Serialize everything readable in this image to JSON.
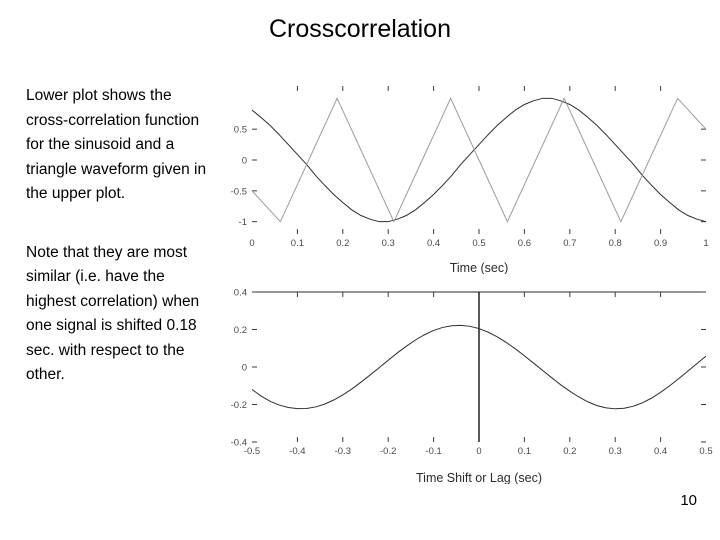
{
  "slide": {
    "title": "Crosscorrelation",
    "page_number": "10"
  },
  "text": {
    "paragraph_one": "Lower plot shows the cross-correlation function for the sinusoid and a triangle waveform given in the upper plot.",
    "paragraph_two": "Note that they are most similar (i.e. have the highest correlation) when one signal is shifted 0.18 sec. with respect to the other."
  },
  "chart_data": [
    {
      "id": "upper-plot",
      "type": "line",
      "title": "",
      "xlabel": "Time (sec)",
      "ylabel": "",
      "xlim": [
        0,
        1
      ],
      "ylim": [
        -1.2,
        1.2
      ],
      "xticks": [
        0,
        0.1,
        0.2,
        0.3,
        0.4,
        0.5,
        0.6,
        0.7,
        0.8,
        0.9,
        1
      ],
      "xticklabels": [
        "0",
        "0.1",
        "0.2",
        "0.3",
        "0.4",
        "0.5",
        "0.6",
        "0.7",
        "0.8",
        "0.9",
        "1"
      ],
      "yticks": [
        -1,
        -0.5,
        0,
        0.5
      ],
      "yticklabels": [
        "-1",
        "-0.5",
        "0",
        "0.5"
      ],
      "grid": false,
      "legend": "none",
      "series": [
        {
          "name": "sinusoid",
          "style": "solid-dark",
          "comment": "cosine-like, amplitude 1, period 0.5 sec, phase shifted",
          "x": [
            0,
            0.02,
            0.04,
            0.06,
            0.08,
            0.1,
            0.12,
            0.14,
            0.16,
            0.18,
            0.2,
            0.22,
            0.24,
            0.26,
            0.28,
            0.3,
            0.32,
            0.34,
            0.36,
            0.38,
            0.4,
            0.42,
            0.44,
            0.46,
            0.48,
            0.5,
            0.52,
            0.54,
            0.56,
            0.58,
            0.6,
            0.62,
            0.64,
            0.66,
            0.68,
            0.7,
            0.72,
            0.74,
            0.76,
            0.78,
            0.8,
            0.82,
            0.84,
            0.86,
            0.88,
            0.9,
            0.92,
            0.94,
            0.96,
            0.98,
            1
          ],
          "y": [
            0.81,
            0.69,
            0.56,
            0.41,
            0.25,
            0.09,
            -0.07,
            -0.25,
            -0.41,
            -0.56,
            -0.69,
            -0.81,
            -0.9,
            -0.96,
            -1.0,
            -1.0,
            -0.96,
            -0.9,
            -0.81,
            -0.69,
            -0.56,
            -0.41,
            -0.25,
            -0.07,
            0.09,
            0.25,
            0.41,
            0.56,
            0.69,
            0.81,
            0.9,
            0.96,
            1.0,
            1.0,
            0.96,
            0.9,
            0.81,
            0.69,
            0.56,
            0.41,
            0.25,
            0.09,
            -0.07,
            -0.25,
            -0.41,
            -0.56,
            -0.69,
            -0.81,
            -0.9,
            -0.96,
            -1.0
          ]
        },
        {
          "name": "triangle waveform",
          "style": "solid-faint",
          "comment": "triangle wave, amplitude 1, period 0.5 sec",
          "x": [
            0,
            0.0625,
            0.1875,
            0.3125,
            0.4375,
            0.5625,
            0.6875,
            0.8125,
            0.9375,
            1.0
          ],
          "y": [
            -0.5,
            -1.0,
            1.0,
            -1.0,
            1.0,
            -1.0,
            1.0,
            -1.0,
            1.0,
            0.5
          ]
        }
      ]
    },
    {
      "id": "lower-plot",
      "type": "line",
      "title": "",
      "xlabel": "Time Shift or Lag (sec)",
      "ylabel": "",
      "xlim": [
        -0.5,
        0.5
      ],
      "ylim": [
        -0.4,
        0.4
      ],
      "xticks": [
        -0.5,
        -0.4,
        -0.3,
        -0.2,
        -0.1,
        0,
        0.1,
        0.2,
        0.3,
        0.4,
        0.5
      ],
      "xticklabels": [
        "-0.5",
        "-0.4",
        "-0.3",
        "-0.2",
        "-0.1",
        "0",
        "0.1",
        "0.2",
        "0.3",
        "0.4",
        "0.5"
      ],
      "yticks": [
        -0.4,
        -0.2,
        0,
        0.2,
        0.4
      ],
      "yticklabels": [
        "-0.4",
        "-0.2",
        "0",
        "0.2",
        "0.4"
      ],
      "grid": false,
      "legend": "none",
      "annotations": [
        {
          "type": "vline",
          "x": 0,
          "label": ""
        }
      ],
      "series": [
        {
          "name": "crosscorrelation function",
          "style": "solid-dark",
          "comment": "peak correlation approx 0.22 at lag -0.18 and 0.32 sec",
          "x": [
            -0.5,
            -0.48,
            -0.46,
            -0.44,
            -0.42,
            -0.4,
            -0.38,
            -0.36,
            -0.34,
            -0.32,
            -0.3,
            -0.28,
            -0.26,
            -0.24,
            -0.22,
            -0.2,
            -0.18,
            -0.16,
            -0.14,
            -0.12,
            -0.1,
            -0.08,
            -0.06,
            -0.04,
            -0.02,
            0,
            0.02,
            0.04,
            0.06,
            0.08,
            0.1,
            0.12,
            0.14,
            0.16,
            0.18,
            0.2,
            0.22,
            0.24,
            0.26,
            0.28,
            0.3,
            0.32,
            0.34,
            0.36,
            0.38,
            0.4,
            0.42,
            0.44,
            0.46,
            0.48,
            0.5
          ],
          "y": [
            -0.12,
            -0.155,
            -0.183,
            -0.203,
            -0.216,
            -0.222,
            -0.221,
            -0.213,
            -0.198,
            -0.176,
            -0.149,
            -0.117,
            -0.081,
            -0.043,
            -0.004,
            0.036,
            0.075,
            0.111,
            0.144,
            0.172,
            0.195,
            0.211,
            0.22,
            0.222,
            0.217,
            0.205,
            0.186,
            0.161,
            0.131,
            0.097,
            0.06,
            0.021,
            -0.018,
            -0.057,
            -0.095,
            -0.129,
            -0.16,
            -0.186,
            -0.206,
            -0.218,
            -0.223,
            -0.22,
            -0.209,
            -0.191,
            -0.166,
            -0.135,
            -0.1,
            -0.062,
            -0.022,
            0.018,
            0.058
          ]
        }
      ]
    }
  ]
}
